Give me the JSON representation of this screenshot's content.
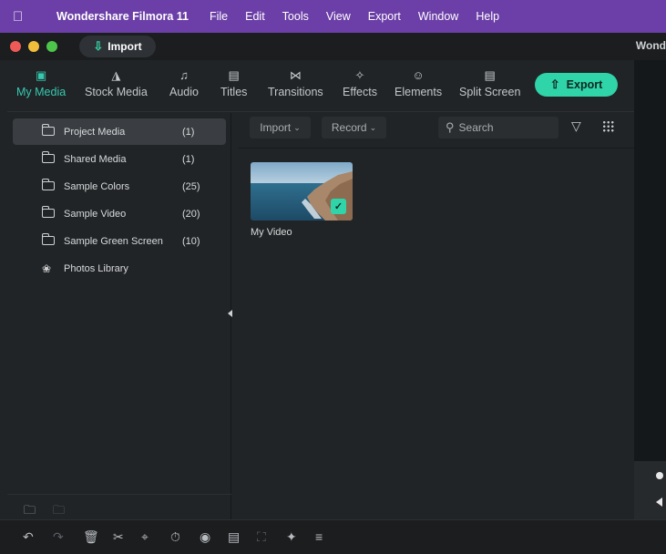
{
  "menubar": {
    "app_name": "Wondershare Filmora 11",
    "items": [
      "File",
      "Edit",
      "Tools",
      "View",
      "Export",
      "Window",
      "Help"
    ]
  },
  "titlebar": {
    "import_label": "Import",
    "title_partial": "Wond"
  },
  "tabs": [
    {
      "label": "My Media",
      "icon": "photo-icon",
      "active": true
    },
    {
      "label": "Stock Media",
      "icon": "camera-folder-icon",
      "active": false
    },
    {
      "label": "Audio",
      "icon": "music-note-icon",
      "active": false
    },
    {
      "label": "Titles",
      "icon": "text-t-icon",
      "active": false
    },
    {
      "label": "Transitions",
      "icon": "transition-icon",
      "active": false
    },
    {
      "label": "Effects",
      "icon": "sparkle-icon",
      "active": false
    },
    {
      "label": "Elements",
      "icon": "smiley-icon",
      "active": false
    },
    {
      "label": "Split Screen",
      "icon": "split-screen-icon",
      "active": false
    }
  ],
  "export_label": "Export",
  "sidebar": {
    "items": [
      {
        "label": "Project Media",
        "count": "(1)",
        "icon": "folder-icon",
        "active": true
      },
      {
        "label": "Shared Media",
        "count": "(1)",
        "icon": "folder-icon",
        "active": false
      },
      {
        "label": "Sample Colors",
        "count": "(25)",
        "icon": "folder-icon",
        "active": false
      },
      {
        "label": "Sample Video",
        "count": "(20)",
        "icon": "folder-icon",
        "active": false
      },
      {
        "label": "Sample Green Screen",
        "count": "(10)",
        "icon": "folder-icon",
        "active": false
      },
      {
        "label": "Photos Library",
        "count": "",
        "icon": "photos-flower-icon",
        "active": false
      }
    ]
  },
  "media_toolbar": {
    "import_label": "Import",
    "record_label": "Record",
    "search_placeholder": "Search"
  },
  "media_items": [
    {
      "label": "My Video",
      "selected": true
    }
  ],
  "colors": {
    "accent": "#2fd4a9",
    "menubar": "#6b3fa7",
    "panel": "#212426"
  }
}
